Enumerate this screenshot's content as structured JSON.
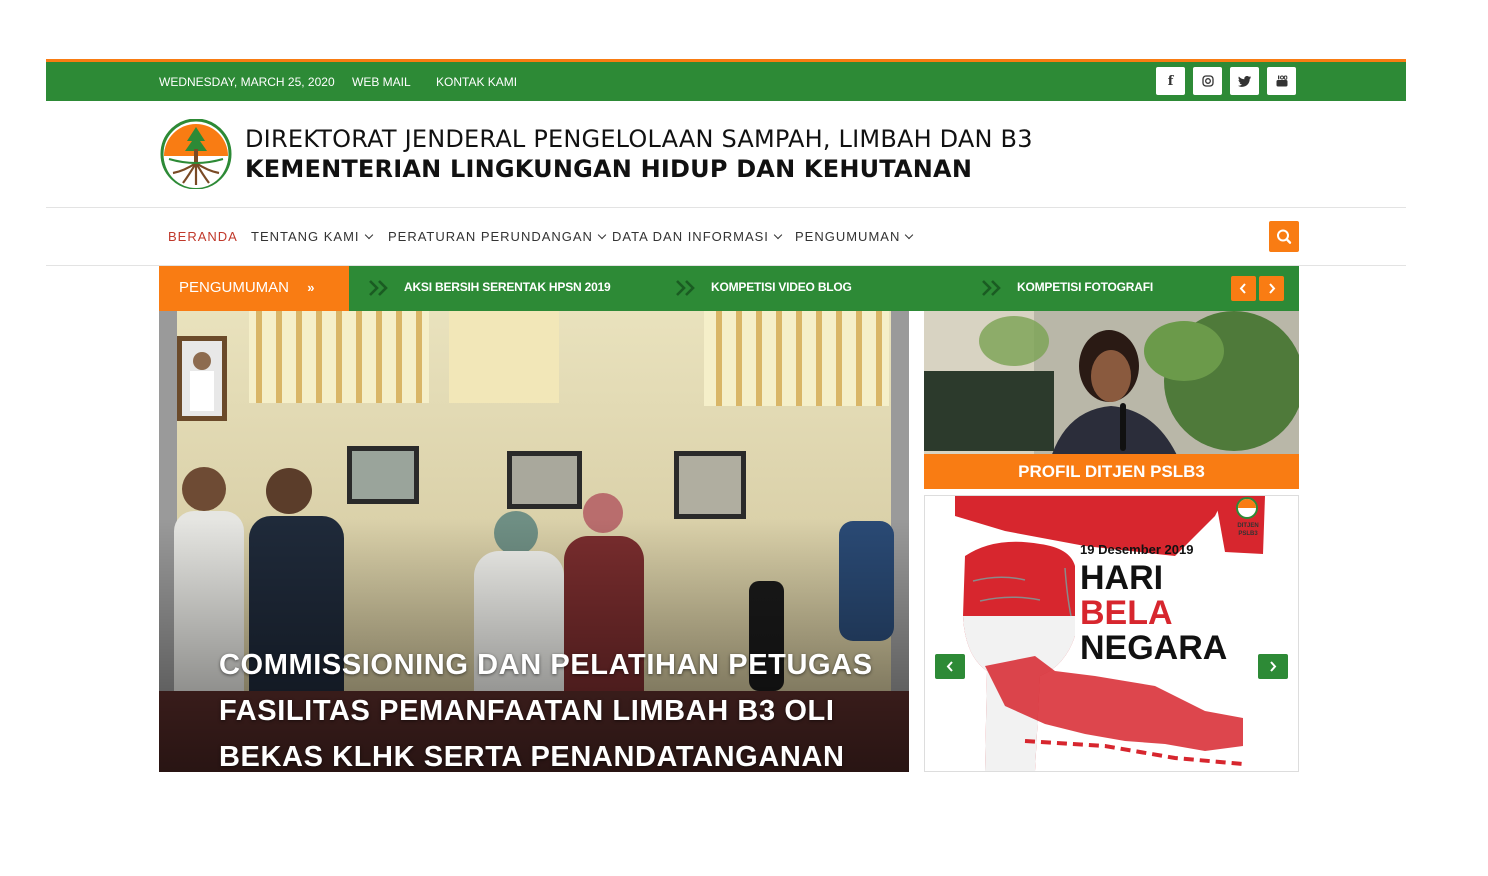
{
  "topbar": {
    "date": "WEDNESDAY, MARCH 25, 2020",
    "links": [
      "WEB MAIL",
      "KONTAK KAMI"
    ],
    "social": [
      "facebook-icon",
      "instagram-icon",
      "twitter-icon",
      "youtube-icon"
    ]
  },
  "header": {
    "title_line1": "DIREKTORAT JENDERAL PENGELOLAAN SAMPAH, LIMBAH DAN B3",
    "title_line2": "KEMENTERIAN LINGKUNGAN HIDUP DAN KEHUTANAN"
  },
  "nav": {
    "items": [
      "BERANDA",
      "TENTANG KAMI",
      "PERATURAN PERUNDANGAN",
      "DATA DAN INFORMASI",
      "PENGUMUMAN"
    ],
    "active": "BERANDA"
  },
  "ticker": {
    "label": "PENGUMUMAN",
    "items": [
      "AKSI BERSIH SERENTAK HPSN 2019",
      "KOMPETISI VIDEO BLOG",
      "KOMPETISI FOTOGRAFI"
    ]
  },
  "hero": {
    "title": "COMMISSIONING DAN PELATIHAN PETUGAS FASILITAS PEMANFAATAN LIMBAH B3 OLI BEKAS KLHK SERTA PENANDATANGANAN"
  },
  "side": {
    "profile_label": "PROFIL DITJEN PSLB3",
    "banner": {
      "date": "19 Desember 2019",
      "line1": "HARI",
      "line2": "BELA",
      "line3": "NEGARA",
      "logo_text": "DITJEN PSLB3"
    }
  },
  "colors": {
    "green": "#2d8a36",
    "orange": "#f97c13",
    "active_nav": "#c0392b"
  }
}
